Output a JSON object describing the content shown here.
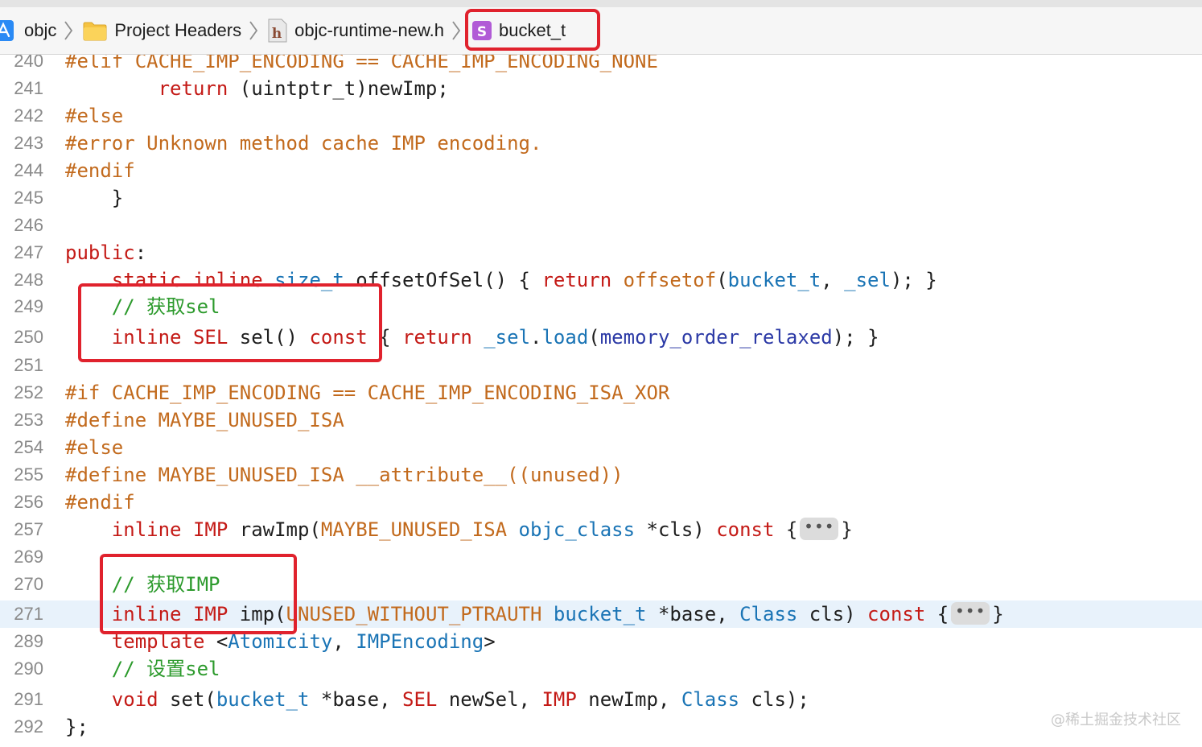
{
  "jumpbar": {
    "crumbs": [
      {
        "label": "objc",
        "icon": "xcode-project-icon"
      },
      {
        "label": "Project Headers",
        "icon": "folder-icon"
      },
      {
        "label": "objc-runtime-new.h",
        "icon": "header-file-icon",
        "icon_glyph": "h"
      },
      {
        "label": "bucket_t",
        "icon": "struct-symbol-icon",
        "icon_glyph": "S"
      }
    ]
  },
  "editor": {
    "current_line": "271",
    "lines": [
      {
        "n": "240",
        "tokens": [
          {
            "t": "#elif CACHE_IMP_ENCODING == CACHE_IMP_ENCODING_NONE",
            "c": "pp"
          }
        ]
      },
      {
        "n": "241",
        "tokens": [
          {
            "t": "        "
          },
          {
            "t": "return",
            "c": "kw"
          },
          {
            "t": " (uintptr_t)newImp;"
          }
        ]
      },
      {
        "n": "242",
        "tokens": [
          {
            "t": "#else",
            "c": "pp"
          }
        ]
      },
      {
        "n": "243",
        "tokens": [
          {
            "t": "#error Unknown method cache IMP encoding.",
            "c": "pp"
          }
        ]
      },
      {
        "n": "244",
        "tokens": [
          {
            "t": "#endif",
            "c": "pp"
          }
        ]
      },
      {
        "n": "245",
        "tokens": [
          {
            "t": "    }"
          }
        ]
      },
      {
        "n": "246",
        "tokens": []
      },
      {
        "n": "247",
        "tokens": [
          {
            "t": "public",
            "c": "kw"
          },
          {
            "t": ":"
          }
        ]
      },
      {
        "n": "248",
        "tokens": [
          {
            "t": "    "
          },
          {
            "t": "static",
            "c": "kw"
          },
          {
            "t": " "
          },
          {
            "t": "inline",
            "c": "kw"
          },
          {
            "t": " "
          },
          {
            "t": "size_t",
            "c": "ty"
          },
          {
            "t": " offsetOfSel() { "
          },
          {
            "t": "return",
            "c": "kw"
          },
          {
            "t": " "
          },
          {
            "t": "offsetof",
            "c": "pp"
          },
          {
            "t": "("
          },
          {
            "t": "bucket_t",
            "c": "ty"
          },
          {
            "t": ", "
          },
          {
            "t": "_sel",
            "c": "ty"
          },
          {
            "t": "); }"
          }
        ]
      },
      {
        "n": "249",
        "tokens": [
          {
            "t": "    "
          },
          {
            "t": "// 获取sel",
            "c": "cm"
          }
        ]
      },
      {
        "n": "250",
        "tokens": [
          {
            "t": "    "
          },
          {
            "t": "inline",
            "c": "kw"
          },
          {
            "t": " "
          },
          {
            "t": "SEL",
            "c": "kw"
          },
          {
            "t": " sel() "
          },
          {
            "t": "const",
            "c": "kw"
          },
          {
            "t": " { "
          },
          {
            "t": "return",
            "c": "kw"
          },
          {
            "t": " "
          },
          {
            "t": "_sel",
            "c": "ty"
          },
          {
            "t": "."
          },
          {
            "t": "load",
            "c": "ty"
          },
          {
            "t": "("
          },
          {
            "t": "memory_order_relaxed",
            "c": "fn"
          },
          {
            "t": "); }"
          }
        ]
      },
      {
        "n": "251",
        "tokens": []
      },
      {
        "n": "252",
        "tokens": [
          {
            "t": "#if CACHE_IMP_ENCODING == CACHE_IMP_ENCODING_ISA_XOR",
            "c": "pp"
          }
        ]
      },
      {
        "n": "253",
        "tokens": [
          {
            "t": "#define MAYBE_UNUSED_ISA",
            "c": "pp"
          }
        ]
      },
      {
        "n": "254",
        "tokens": [
          {
            "t": "#else",
            "c": "pp"
          }
        ]
      },
      {
        "n": "255",
        "tokens": [
          {
            "t": "#define MAYBE_UNUSED_ISA __attribute__((unused))",
            "c": "pp"
          }
        ]
      },
      {
        "n": "256",
        "tokens": [
          {
            "t": "#endif",
            "c": "pp"
          }
        ]
      },
      {
        "n": "257",
        "tokens": [
          {
            "t": "    "
          },
          {
            "t": "inline",
            "c": "kw"
          },
          {
            "t": " "
          },
          {
            "t": "IMP",
            "c": "kw"
          },
          {
            "t": " rawImp("
          },
          {
            "t": "MAYBE_UNUSED_ISA",
            "c": "pp"
          },
          {
            "t": " "
          },
          {
            "t": "objc_class",
            "c": "ty"
          },
          {
            "t": " *cls) "
          },
          {
            "t": "const",
            "c": "kw"
          },
          {
            "t": " {"
          },
          {
            "fold": "•••"
          },
          {
            "t": "}"
          }
        ]
      },
      {
        "n": "269",
        "tokens": []
      },
      {
        "n": "270",
        "tokens": [
          {
            "t": "    "
          },
          {
            "t": "// 获取IMP",
            "c": "cm"
          }
        ]
      },
      {
        "n": "271",
        "tokens": [
          {
            "t": "    "
          },
          {
            "t": "inline",
            "c": "kw"
          },
          {
            "t": " "
          },
          {
            "t": "IMP",
            "c": "kw"
          },
          {
            "t": " imp("
          },
          {
            "t": "UNUSED_WITHOUT_PTRAUTH",
            "c": "pp"
          },
          {
            "t": " "
          },
          {
            "t": "bucket_t",
            "c": "ty"
          },
          {
            "t": " *base, "
          },
          {
            "t": "Class",
            "c": "ty"
          },
          {
            "t": " cls) "
          },
          {
            "t": "const",
            "c": "kw"
          },
          {
            "t": " {"
          },
          {
            "fold": "•••"
          },
          {
            "t": "}"
          }
        ]
      },
      {
        "n": "289",
        "tokens": [
          {
            "t": "    "
          },
          {
            "t": "template",
            "c": "kw"
          },
          {
            "t": " <"
          },
          {
            "t": "Atomicity",
            "c": "ty"
          },
          {
            "t": ", "
          },
          {
            "t": "IMPEncoding",
            "c": "ty"
          },
          {
            "t": ">"
          }
        ]
      },
      {
        "n": "290",
        "tokens": [
          {
            "t": "    "
          },
          {
            "t": "// 设置sel",
            "c": "cm"
          }
        ]
      },
      {
        "n": "291",
        "tokens": [
          {
            "t": "    "
          },
          {
            "t": "void",
            "c": "kw"
          },
          {
            "t": " set("
          },
          {
            "t": "bucket_t",
            "c": "ty"
          },
          {
            "t": " *base, "
          },
          {
            "t": "SEL",
            "c": "kw"
          },
          {
            "t": " newSel, "
          },
          {
            "t": "IMP",
            "c": "kw"
          },
          {
            "t": " newImp, "
          },
          {
            "t": "Class",
            "c": "ty"
          },
          {
            "t": " cls);"
          }
        ]
      },
      {
        "n": "292",
        "tokens": [
          {
            "t": "};"
          }
        ]
      }
    ]
  },
  "watermark": "@稀土掘金技术社区",
  "colors": {
    "keyword": "#c41a16",
    "preprocessor": "#c26a1d",
    "type": "#1a74b5",
    "function": "#2c3aa6",
    "comment": "#2c9a2c",
    "annotation_box": "#e0222d",
    "current_line_bg": "#e8f2fb"
  }
}
